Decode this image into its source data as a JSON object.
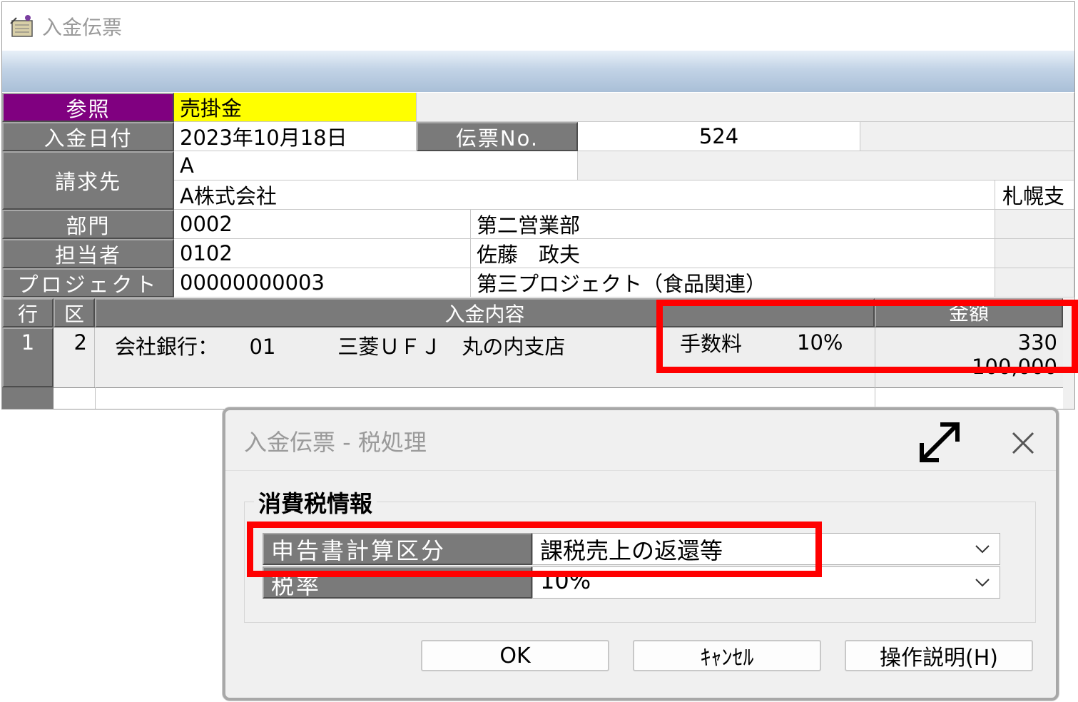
{
  "window": {
    "title": "入金伝票"
  },
  "form": {
    "reference_label": "参照",
    "reference_value": "売掛金",
    "date_label": "入金日付",
    "date_value": "2023年10月18日",
    "slip_no_label": "伝票No.",
    "slip_no_value": "524",
    "billing_label": "請求先",
    "billing_code": "A",
    "billing_name": "A株式会社",
    "billing_branch": "札幌支",
    "dept_label": "部門",
    "dept_code": "0002",
    "dept_name": "第二営業部",
    "staff_label": "担当者",
    "staff_code": "0102",
    "staff_name": "佐藤　政夫",
    "project_label": "プロジェクト",
    "project_code": "00000000003",
    "project_name": "第三プロジェクト（食品関連）"
  },
  "grid": {
    "headers": {
      "row": "行",
      "kubun": "区",
      "content": "入金内容",
      "amount": "金額"
    },
    "rows": [
      {
        "row": "1",
        "kubun": "2",
        "content": "会社銀行：　　01　　　三菱ＵＦＪ　丸の内支店",
        "fee_label": "手数料",
        "fee_rate": "10%",
        "amount": "330",
        "amount2": "100,000"
      }
    ]
  },
  "dialog": {
    "title": "入金伝票 - 税処理",
    "group_title": "消費税情報",
    "report_calc_label": "申告書計算区分",
    "report_calc_value": "課税売上の返還等",
    "tax_rate_label": "税率",
    "tax_rate_value": "10%",
    "ok_label": "OK",
    "cancel_label": "ｷｬﾝｾﾙ",
    "help_label": "操作説明(H)"
  },
  "colors": {
    "purple": "#800080",
    "yellow": "#ffff00",
    "highlight_red": "#ff0000"
  }
}
